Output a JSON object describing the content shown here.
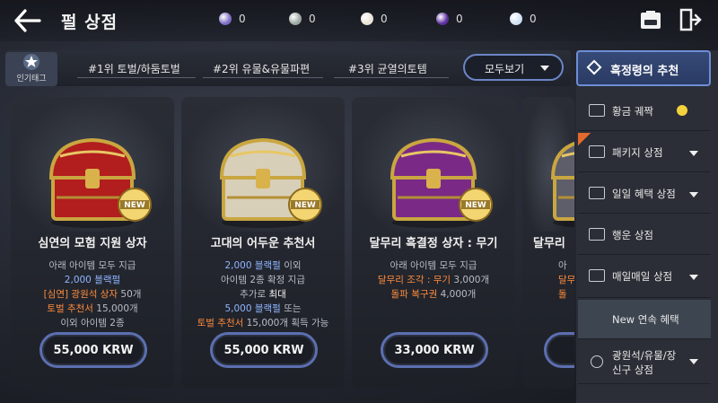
{
  "header": {
    "title": "펄 상점",
    "currencies": [
      {
        "icon": "purple-m-coin-icon",
        "value": "0",
        "color": "#7d6bc4"
      },
      {
        "icon": "silver-coin-icon",
        "value": "0",
        "color": "#9aa6a0"
      },
      {
        "icon": "pearl-icon",
        "value": "0",
        "color": "#e9e2d6"
      },
      {
        "icon": "purple-orb-icon",
        "value": "0",
        "color": "#5a2c9c"
      },
      {
        "icon": "crystal-icon",
        "value": "0",
        "color": "#cfe0f2"
      }
    ]
  },
  "tags": {
    "popular_label": "인기태그",
    "items": [
      "#1위 토벌/하둠토벌",
      "#2위 유물&유물파편",
      "#3위 균열의토템"
    ],
    "view_all": "모두보기"
  },
  "cards": [
    {
      "name": "심연의 모험 지원 상자",
      "badge": "NEW",
      "chest_color": "#b21d1d",
      "lines": [
        [
          {
            "t": "아래 아이템 모두 지급",
            "c": "gray"
          }
        ],
        [
          {
            "t": "2,000 블랙펄",
            "c": "blue"
          }
        ],
        [
          {
            "t": "[심연] 광원석 상자",
            "c": "orange"
          },
          {
            "t": " 50개",
            "c": "gray"
          }
        ],
        [
          {
            "t": "토벌 추천서",
            "c": "orange"
          },
          {
            "t": " 15,000개",
            "c": "gray"
          }
        ],
        [
          {
            "t": "이외 아이템 2종",
            "c": "gray"
          }
        ]
      ],
      "price": "55,000 KRW"
    },
    {
      "name": "고대의 어두운 추천서",
      "badge": "NEW",
      "chest_color": "#d8cfb8",
      "lines": [
        [
          {
            "t": "2,000 블랙펄",
            "c": "blue"
          },
          {
            "t": " 이외",
            "c": "gray"
          }
        ],
        [
          {
            "t": "아이템 2종 확정 지급",
            "c": "gray"
          }
        ],
        [
          {
            "t": "추가로 ",
            "c": "gray"
          },
          {
            "t": "최대",
            "c": "white"
          }
        ],
        [
          {
            "t": "5,000 블랙펄",
            "c": "blue"
          },
          {
            "t": " 또는",
            "c": "gray"
          }
        ],
        [
          {
            "t": "토벌 추천서",
            "c": "orange"
          },
          {
            "t": " 15,000개 획득 가능",
            "c": "gray"
          }
        ]
      ],
      "price": "55,000 KRW"
    },
    {
      "name": "달무리 흑결정 상자 : 무기",
      "badge": "NEW",
      "chest_color": "#7a2a86",
      "lines": [
        [
          {
            "t": "아래 아이템 모두 지급",
            "c": "gray"
          }
        ],
        [
          {
            "t": "달무리 조각 : 무기",
            "c": "orange"
          },
          {
            "t": " 3,000개",
            "c": "gray"
          }
        ],
        [
          {
            "t": "돌파 복구권",
            "c": "orange"
          },
          {
            "t": " 4,000개",
            "c": "gray"
          }
        ]
      ],
      "price": "33,000 KRW"
    },
    {
      "name": "달무리",
      "badge": "",
      "chest_color": "#5e5e6a",
      "lines": [
        [
          {
            "t": "아",
            "c": "gray"
          }
        ],
        [
          {
            "t": "달무리",
            "c": "orange"
          }
        ],
        [
          {
            "t": "돌",
            "c": "orange"
          }
        ]
      ],
      "price": ""
    }
  ],
  "sidebar": {
    "title": "흑정령의 추천",
    "items": [
      {
        "label": "황금 궤짝",
        "icon": "chest-icon",
        "coin": true,
        "arrow": false,
        "active": false
      },
      {
        "label": "패키지 상점",
        "icon": "package-box-icon",
        "coin": false,
        "arrow": true,
        "active": false,
        "ribbon": true
      },
      {
        "label": "일일 혜택 상점",
        "icon": "package-box-icon",
        "coin": false,
        "arrow": true,
        "active": false
      },
      {
        "label": "행운 상점",
        "icon": "chest-icon",
        "coin": false,
        "arrow": false,
        "active": false
      },
      {
        "label": "매일매일 상점",
        "icon": "package-box-icon",
        "coin": false,
        "arrow": true,
        "active": false
      },
      {
        "label": "New 연속 혜택",
        "icon": "",
        "coin": false,
        "arrow": false,
        "active": true
      },
      {
        "label": "광원석/유물/장",
        "label2": "신구 상점",
        "icon": "ring-icon",
        "coin": false,
        "arrow": true,
        "active": false
      }
    ]
  }
}
